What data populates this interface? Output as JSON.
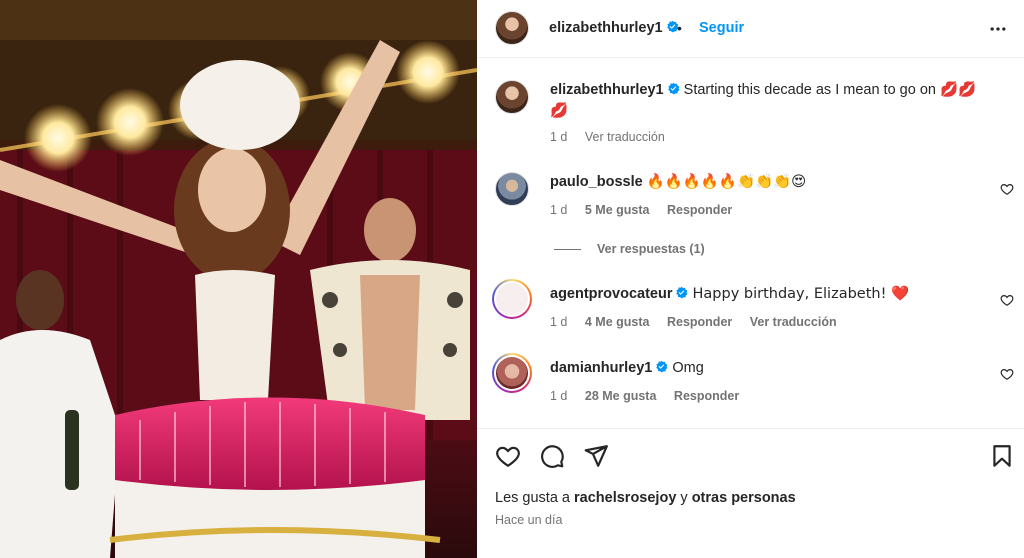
{
  "photo": {
    "alt": "Party photo with woman in corset emerging from a birthday cake"
  },
  "header": {
    "username": "elizabethhurley1",
    "separator": "•",
    "follow_label": "Seguir"
  },
  "caption": {
    "username": "elizabethhurley1",
    "text": "Starting this decade as I mean to go on",
    "emoji": "💋💋💋",
    "time": "1 d",
    "translate": "Ver traducción"
  },
  "comments": [
    {
      "username": "paulo_bossle",
      "text": "🔥🔥🔥🔥🔥👏👏👏😍",
      "time": "1 d",
      "likes": "5 Me gusta",
      "reply": "Responder",
      "view_replies": "Ver respuestas (1)"
    },
    {
      "username": "agentprovocateur",
      "text": "Happy birthday, Elizabeth! ❤️",
      "time": "1 d",
      "likes": "4 Me gusta",
      "reply": "Responder",
      "translate": "Ver traducción"
    },
    {
      "username": "damianhurley1",
      "text": "Omg",
      "time": "1 d",
      "likes": "28 Me gusta",
      "reply": "Responder"
    }
  ],
  "footer": {
    "likes_prefix": "Les gusta a",
    "likes_user": "rachelsrosejoy",
    "likes_conj": "y",
    "likes_others": "otras personas",
    "time": "Hace un día"
  },
  "colors": {
    "accent": "#0095f6",
    "verified": "#0095f6",
    "muted": "#737373",
    "text": "#262626"
  }
}
